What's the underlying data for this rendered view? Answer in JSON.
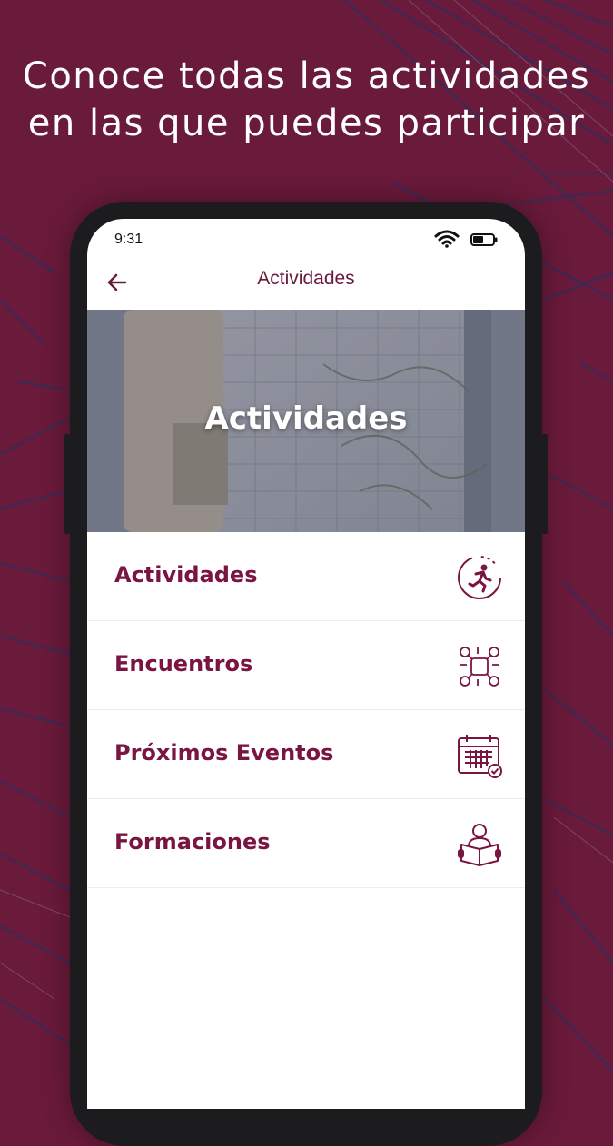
{
  "headline": {
    "line1": "Conoce todas las actividades",
    "line2": "en las que puedes participar"
  },
  "colors": {
    "background": "#6a1a3a",
    "accent": "#7a1441",
    "lines": "#2b2f5e"
  },
  "status_bar": {
    "time": "9:31",
    "icons": [
      "wifi-icon",
      "battery-icon"
    ]
  },
  "app_bar": {
    "title": "Actividades",
    "back_icon": "arrow-left-icon"
  },
  "hero": {
    "title": "Actividades"
  },
  "menu": [
    {
      "label": "Actividades",
      "icon": "running-person-icon"
    },
    {
      "label": "Encuentros",
      "icon": "people-meeting-icon"
    },
    {
      "label": "Próximos Eventos",
      "icon": "calendar-check-icon"
    },
    {
      "label": "Formaciones",
      "icon": "person-reading-icon"
    }
  ]
}
